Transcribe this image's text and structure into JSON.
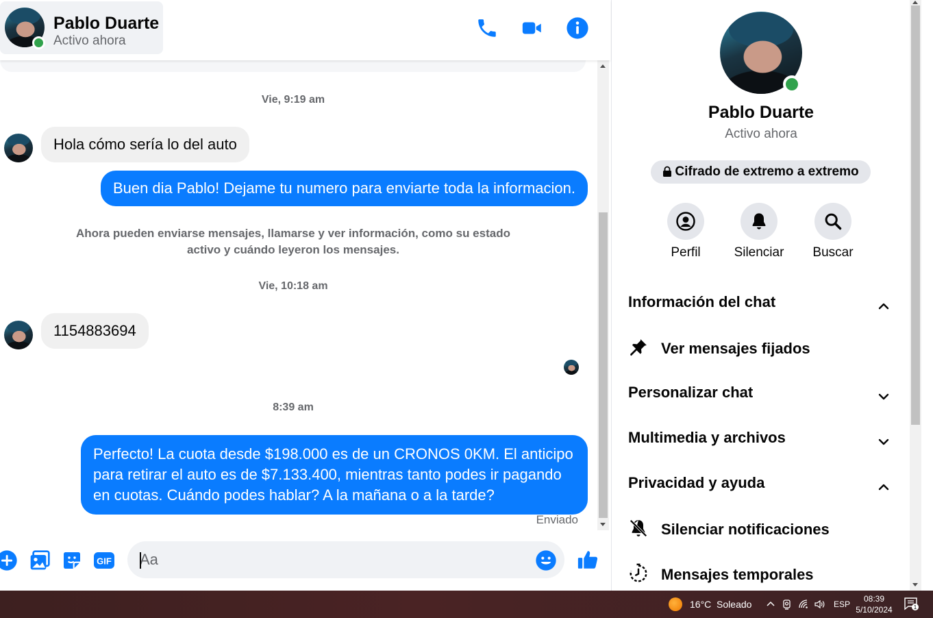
{
  "header": {
    "name": "Pablo Duarte",
    "status": "Activo ahora",
    "icons": [
      "phone-icon",
      "video-camera-icon",
      "info-icon"
    ]
  },
  "conversation": {
    "timestamp_1": "Vie, 9:19 am",
    "msg_in_1": "Hola cómo sería lo del auto",
    "msg_out_1": "Buen dia Pablo! Dejame tu numero para enviarte toda la informacion.",
    "system_note": "Ahora pueden enviarse mensajes, llamarse y ver información, como su estado activo y cuándo leyeron los mensajes.",
    "timestamp_2": "Vie, 10:18 am",
    "msg_in_2": "1154883694",
    "timestamp_3": "8:39 am",
    "msg_out_2": "Perfecto! La cuota desde $198.000 es de un CRONOS 0KM. El anticipo para retirar el auto es de $7.133.400, mientras tanto podes ir pagando en cuotas. Cuándo podes hablar? A la mañana o a la tarde?",
    "sent_label": "Enviado"
  },
  "composer": {
    "placeholder": "Aa",
    "icons": [
      "plus-icon",
      "image-icon",
      "sticker-icon",
      "gif-icon",
      "emoji-icon",
      "like-icon"
    ],
    "gif_label": "GIF"
  },
  "side": {
    "name": "Pablo Duarte",
    "status": "Activo ahora",
    "encryption": "Cifrado de extremo a extremo",
    "actions": [
      {
        "label": "Perfil",
        "icon": "profile-icon"
      },
      {
        "label": "Silenciar",
        "icon": "bell-icon"
      },
      {
        "label": "Buscar",
        "icon": "search-icon"
      }
    ],
    "sections": {
      "chat_info": "Información del chat",
      "pinned": "Ver mensajes fijados",
      "customize": "Personalizar chat",
      "media": "Multimedia y archivos",
      "privacy": "Privacidad y ayuda",
      "mute_notifications": "Silenciar notificaciones",
      "temporary": "Mensajes temporales"
    }
  },
  "taskbar": {
    "weather": "16°C  Soleado",
    "language": "ESP",
    "time": "08:39",
    "date": "5/10/2024",
    "notification_count": "1"
  },
  "colors": {
    "accent": "#0a7cff",
    "online": "#31a24c"
  }
}
